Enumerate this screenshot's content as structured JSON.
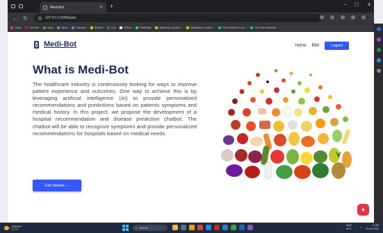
{
  "browser": {
    "tab_title": "Medi-Bot",
    "address": "127.0.0.1:5000/user",
    "bookmarks": [
      "Gmail",
      "YouTube",
      "Maps",
      "News",
      "Translate",
      "Binance",
      "Dell",
      "GitHub",
      "WhatsApp",
      "Madhavan Opportu...",
      "Applications | Amaz...",
      "Khan Academy Lord...",
      "The Khan Academy"
    ]
  },
  "nav": {
    "logo": "Medi-Bot",
    "home": "Home",
    "bmi": "BMI",
    "logout": "Logout"
  },
  "hero": {
    "title": "What is Medi-Bot",
    "description": "The healthcare industry is continuously looking for ways to improve patient experience and outcomes. One way to achieve this is by leveraging artificial intelligence (AI) to provide personalized recommendations and predictions based on patients symptoms and medical history. In this project, we propose the development of a hospital recommendation and disease prediction chatbot. The chatbot will be able to recognize symptoms and provide personalized recommendations for hospitals based on medical needs.",
    "cta": "Get Started →",
    "image_icon": "fruits-vegetables-illustration"
  },
  "taskbar": {
    "weather_temp": "USD/INR",
    "weather_sub": "+0.4%",
    "search": "Search",
    "lang": "ENG\nINTL",
    "time": "12:30",
    "date": "13-03-2024"
  },
  "colors": {
    "accent": "#3358f5",
    "title": "#1a2a52",
    "chat": "#e03545"
  }
}
